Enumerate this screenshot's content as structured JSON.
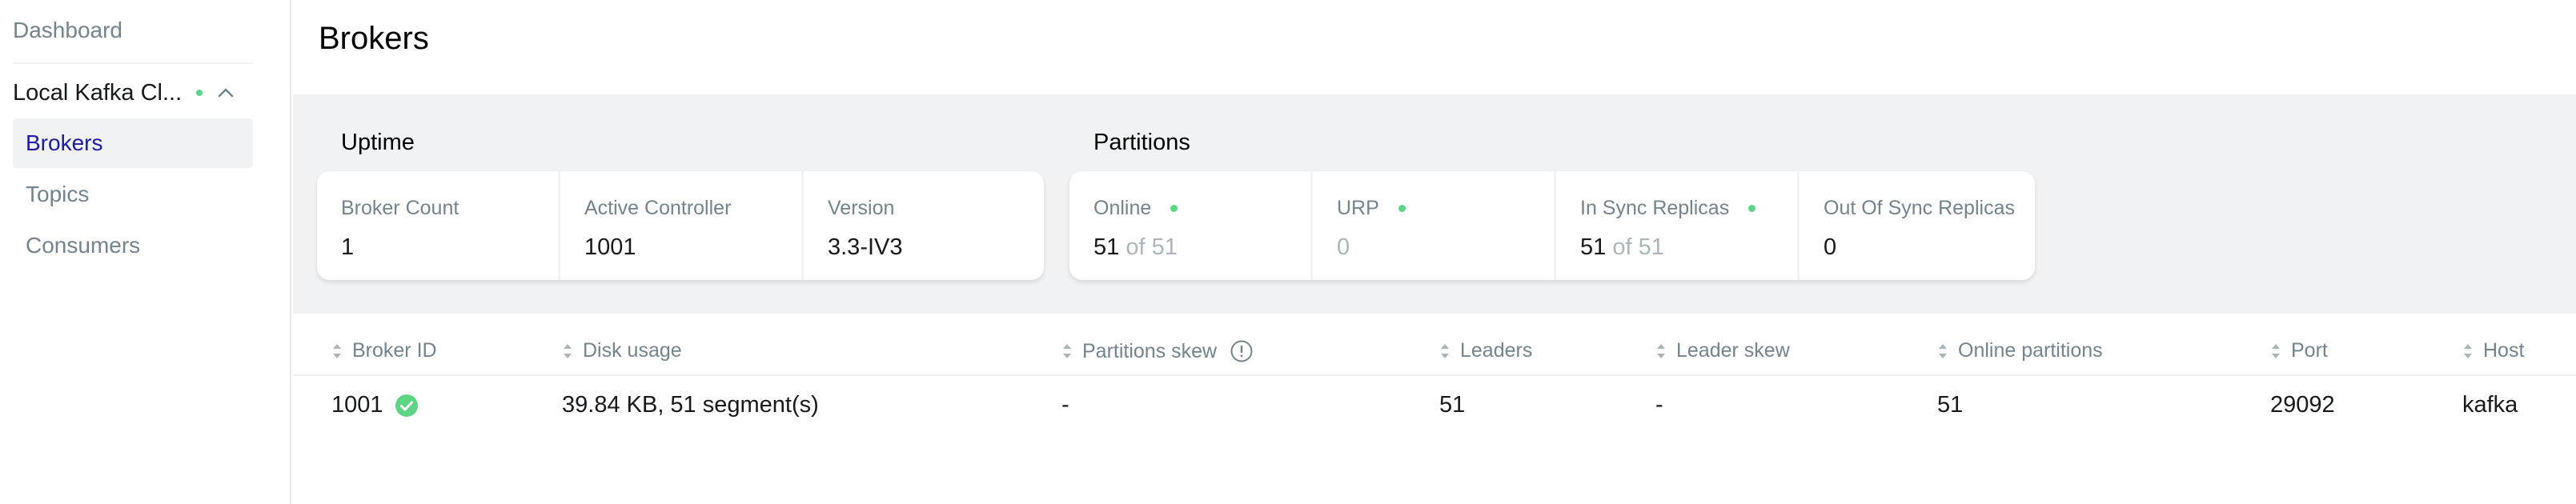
{
  "sidebar": {
    "dashboard_label": "Dashboard",
    "cluster_name": "Local Kafka Cl...",
    "cluster_status_color": "#5cd685",
    "menu": [
      {
        "label": "Brokers",
        "active": true
      },
      {
        "label": "Topics",
        "active": false
      },
      {
        "label": "Consumers",
        "active": false
      }
    ]
  },
  "page": {
    "title": "Brokers"
  },
  "uptime": {
    "title": "Uptime",
    "metrics": [
      {
        "label": "Broker Count",
        "value": "1"
      },
      {
        "label": "Active Controller",
        "value": "1001"
      },
      {
        "label": "Version",
        "value": "3.3-IV3"
      }
    ]
  },
  "partitions": {
    "title": "Partitions",
    "metrics": [
      {
        "label": "Online",
        "value": "51",
        "suffix": " of 51",
        "status": "ok"
      },
      {
        "label": "URP",
        "value": "0",
        "status": "ok"
      },
      {
        "label": "In Sync Replicas",
        "value": "51",
        "suffix": " of 51",
        "status": "ok"
      },
      {
        "label": "Out Of Sync Replicas",
        "value": "0"
      }
    ]
  },
  "table": {
    "columns": [
      "Broker ID",
      "Disk usage",
      "Partitions skew",
      "Leaders",
      "Leader skew",
      "Online partitions",
      "Port",
      "Host"
    ],
    "rows": [
      {
        "broker_id": "1001",
        "disk_usage": "39.84 KB, 51 segment(s)",
        "partitions_skew": "-",
        "leaders": "51",
        "leader_skew": "-",
        "online_partitions": "51",
        "port": "29092",
        "host": "kafka"
      }
    ]
  },
  "colors": {
    "accent": "#1e1aa6",
    "status_ok": "#5cd685",
    "muted_text": "#73848c",
    "band_bg": "#f1f2f3"
  }
}
